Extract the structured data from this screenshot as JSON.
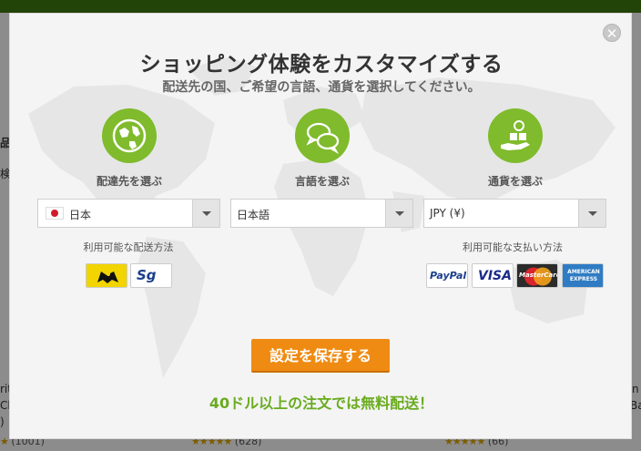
{
  "background": {
    "ratings": [
      {
        "stars": "★",
        "count": "(1001)"
      },
      {
        "stars": "★★★★★",
        "count": "(628)"
      },
      {
        "stars": "★★★★★",
        "count": "(66)"
      }
    ],
    "left_fragments": [
      "品目",
      "検",
      "rit",
      "Cl",
      ")"
    ],
    "right_fragments": [
      "n",
      "Ba"
    ]
  },
  "modal": {
    "title": "ショッピング体験をカスタマイズする",
    "subtitle": "配送先の国、ご希望の言語、通貨を選択してください。",
    "close_glyph": "✕",
    "steps": [
      {
        "icon": "globe-icon",
        "label": "配達先を選ぶ"
      },
      {
        "icon": "chat-bubbles-icon",
        "label": "言語を選ぶ"
      },
      {
        "icon": "coins-hand-icon",
        "label": "通貨を選ぶ"
      }
    ],
    "selects": {
      "country": "日本",
      "language": "日本語",
      "currency": "JPY (¥)"
    },
    "shipping_label": "利用可能な配送方法",
    "payment_label": "利用可能な支払い方法",
    "shipping_logos": [
      "yamato-logo",
      "sagawa-logo"
    ],
    "sagawa_text": "Sg",
    "payment_logos": [
      {
        "name": "paypal",
        "text": "PayPal"
      },
      {
        "name": "visa",
        "text": "VISA"
      },
      {
        "name": "mastercard",
        "text": "MasterCard"
      },
      {
        "name": "amex",
        "text": "AMERICAN EXPRESS"
      }
    ],
    "save_button": "設定を保存する",
    "promo": "40ドル以上の注文では無料配送！",
    "colors": {
      "accent_green": "#7fbb2c",
      "button_orange": "#ef8b12",
      "promo_green": "#6aab1f"
    }
  }
}
